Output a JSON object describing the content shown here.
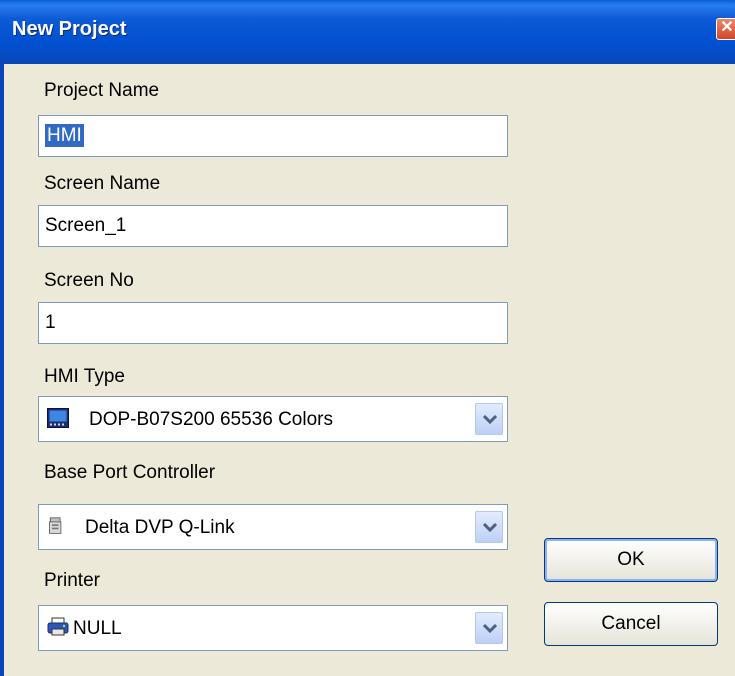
{
  "window": {
    "title": "New Project",
    "close_glyph": "✕"
  },
  "fields": {
    "project_name": {
      "label": "Project Name",
      "value": "HMI"
    },
    "screen_name": {
      "label": "Screen Name",
      "value": "Screen_1"
    },
    "screen_no": {
      "label": "Screen No",
      "value": "1"
    },
    "hmi_type": {
      "label": "HMI Type",
      "value": "DOP-B07S200 65536 Colors",
      "icon": "hmi-screen-icon"
    },
    "base_port_controller": {
      "label": "Base Port Controller",
      "value": "Delta DVP Q-Link",
      "icon": "plc-icon"
    },
    "printer": {
      "label": "Printer",
      "value": "NULL",
      "icon": "printer-icon"
    }
  },
  "buttons": {
    "ok": "OK",
    "cancel": "Cancel"
  },
  "colors": {
    "titlebar": "#0050d0",
    "dialog_bg": "#ece9d8",
    "selection": "#316ac5",
    "close": "#d2452a"
  }
}
